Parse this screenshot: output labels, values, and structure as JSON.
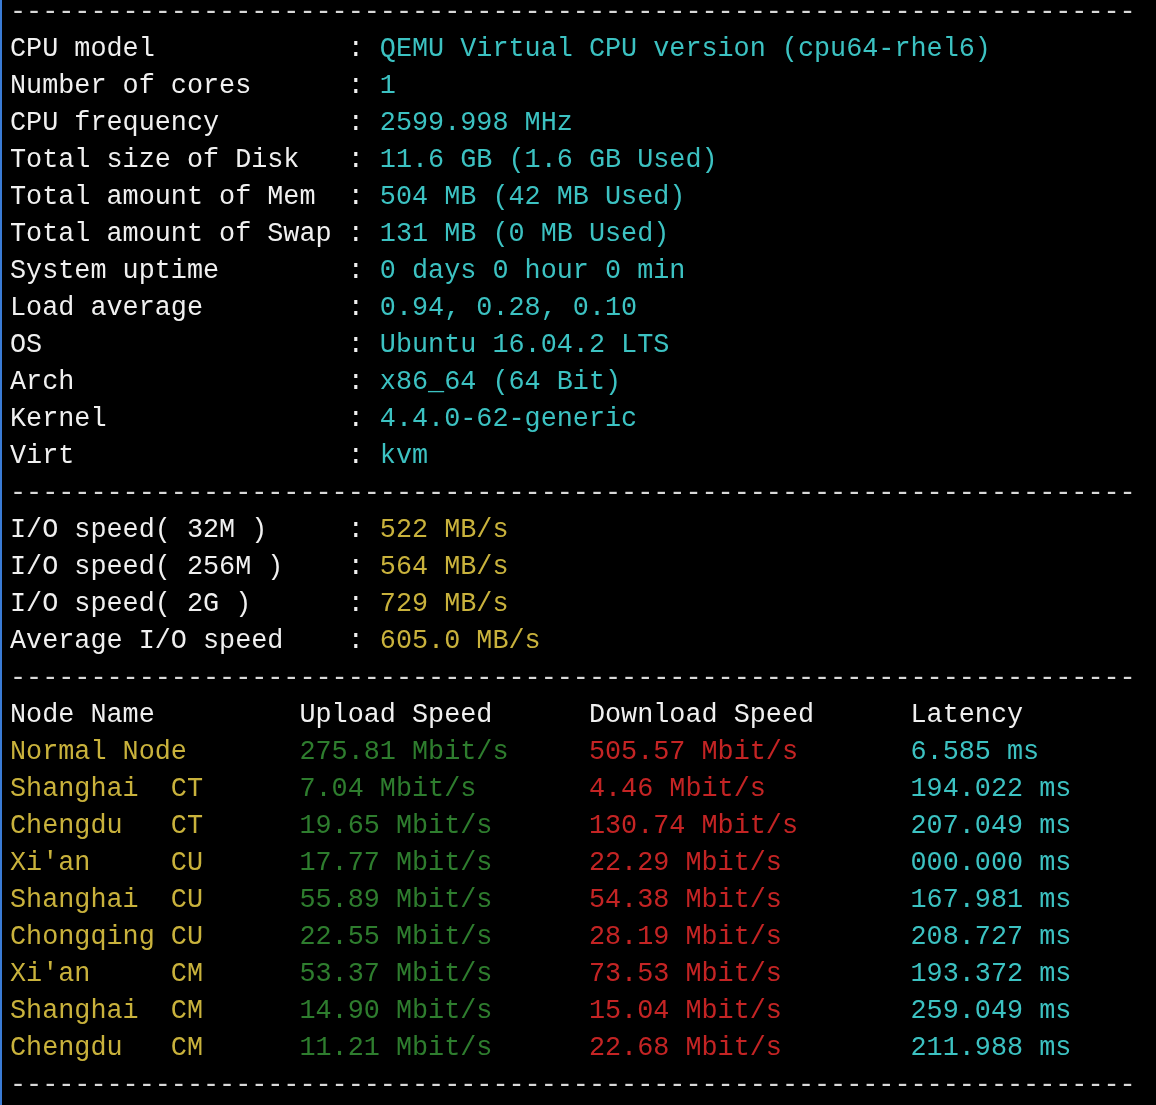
{
  "system_info": {
    "separator": "----------------------------------------------------------------------",
    "delimiter": ":",
    "rows": [
      {
        "label": "CPU model",
        "value": "QEMU Virtual CPU version (cpu64-rhel6)"
      },
      {
        "label": "Number of cores",
        "value": "1"
      },
      {
        "label": "CPU frequency",
        "value": "2599.998 MHz"
      },
      {
        "label": "Total size of Disk",
        "value": "11.6 GB (1.6 GB Used)"
      },
      {
        "label": "Total amount of Mem",
        "value": "504 MB (42 MB Used)"
      },
      {
        "label": "Total amount of Swap",
        "value": "131 MB (0 MB Used)"
      },
      {
        "label": "System uptime",
        "value": "0 days 0 hour 0 min"
      },
      {
        "label": "Load average",
        "value": "0.94, 0.28, 0.10"
      },
      {
        "label": "OS",
        "value": "Ubuntu 16.04.2 LTS"
      },
      {
        "label": "Arch",
        "value": "x86_64 (64 Bit)"
      },
      {
        "label": "Kernel",
        "value": "4.4.0-62-generic"
      },
      {
        "label": "Virt",
        "value": "kvm"
      }
    ]
  },
  "io_test": {
    "separator": "----------------------------------------------------------------------",
    "delimiter": ":",
    "rows": [
      {
        "label": "I/O speed( 32M )",
        "value": "522 MB/s"
      },
      {
        "label": "I/O speed( 256M )",
        "value": "564 MB/s"
      },
      {
        "label": "I/O speed( 2G )",
        "value": "729 MB/s"
      },
      {
        "label": "Average I/O speed",
        "value": "605.0 MB/s"
      }
    ]
  },
  "network_test": {
    "separator": "----------------------------------------------------------------------",
    "columns": [
      "Node Name",
      "Upload Speed",
      "Download Speed",
      "Latency"
    ],
    "rows": [
      {
        "node": "Normal Node",
        "upload": "275.81 Mbit/s",
        "download": "505.57 Mbit/s",
        "latency": "6.585 ms"
      },
      {
        "node": "Shanghai",
        "isp": "CT",
        "upload": "7.04 Mbit/s",
        "download": "4.46 Mbit/s",
        "latency": "194.022 ms"
      },
      {
        "node": "Chengdu",
        "isp": "CT",
        "upload": "19.65 Mbit/s",
        "download": "130.74 Mbit/s",
        "latency": "207.049 ms"
      },
      {
        "node": "Xi'an",
        "isp": "CU",
        "upload": "17.77 Mbit/s",
        "download": "22.29 Mbit/s",
        "latency": "000.000 ms"
      },
      {
        "node": "Shanghai",
        "isp": "CU",
        "upload": "55.89 Mbit/s",
        "download": "54.38 Mbit/s",
        "latency": "167.981 ms"
      },
      {
        "node": "Chongqing",
        "isp": "CU",
        "upload": "22.55 Mbit/s",
        "download": "28.19 Mbit/s",
        "latency": "208.727 ms"
      },
      {
        "node": "Xi'an",
        "isp": "CM",
        "upload": "53.37 Mbit/s",
        "download": "73.53 Mbit/s",
        "latency": "193.372 ms"
      },
      {
        "node": "Shanghai",
        "isp": "CM",
        "upload": "14.90 Mbit/s",
        "download": "15.04 Mbit/s",
        "latency": "259.049 ms"
      },
      {
        "node": "Chengdu",
        "isp": "CM",
        "upload": "11.21 Mbit/s",
        "download": "22.68 Mbit/s",
        "latency": "211.988 ms"
      }
    ]
  },
  "closing_separator": "----------------------------------------------------------------------"
}
